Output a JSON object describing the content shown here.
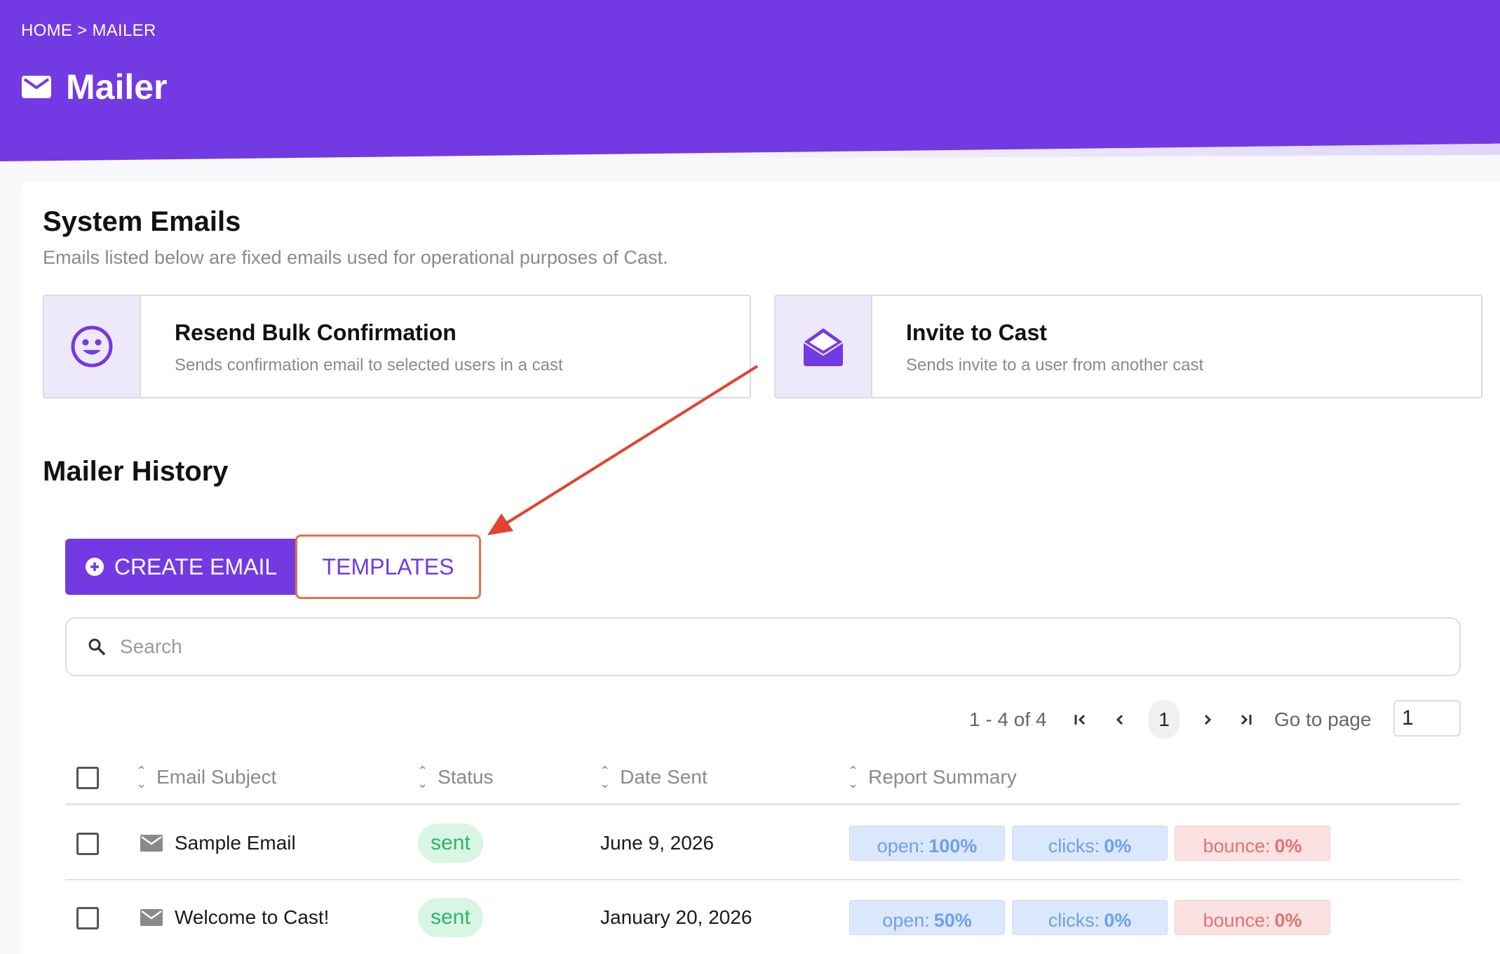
{
  "header": {
    "breadcrumb": "HOME > MAILER",
    "title": "Mailer"
  },
  "system_emails": {
    "title": "System Emails",
    "subtitle": "Emails listed below are fixed emails used for operational purposes of Cast.",
    "cards": [
      {
        "title": "Resend Bulk Confirmation",
        "description": "Sends confirmation email to selected users in a cast",
        "icon": "smiley-icon"
      },
      {
        "title": "Invite to Cast",
        "description": "Sends invite to a user from another cast",
        "icon": "open-envelope-icon"
      }
    ]
  },
  "history": {
    "title": "Mailer History",
    "create_label": "CREATE EMAIL",
    "templates_label": "TEMPLATES",
    "search_placeholder": "Search",
    "pager": {
      "range": "1 - 4 of 4",
      "current_page": "1",
      "goto_label": "Go to page",
      "goto_value": "1"
    },
    "columns": [
      "Email Subject",
      "Status",
      "Date Sent",
      "Report Summary"
    ],
    "rows": [
      {
        "subject": "Sample Email",
        "status": "sent",
        "date": "June 9, 2026",
        "open_label": "open:",
        "open": "100%",
        "clicks_label": "clicks:",
        "clicks": "0%",
        "bounce_label": "bounce:",
        "bounce": "0%"
      },
      {
        "subject": "Welcome to Cast!",
        "status": "sent",
        "date": "January 20, 2026",
        "open_label": "open:",
        "open": "50%",
        "clicks_label": "clicks:",
        "clicks": "0%",
        "bounce_label": "bounce:",
        "bounce": "0%"
      }
    ]
  },
  "colors": {
    "brand": "#7339e3",
    "highlight": "#e8704a",
    "arrow": "#e4432d",
    "sent": "#2fb36a"
  }
}
